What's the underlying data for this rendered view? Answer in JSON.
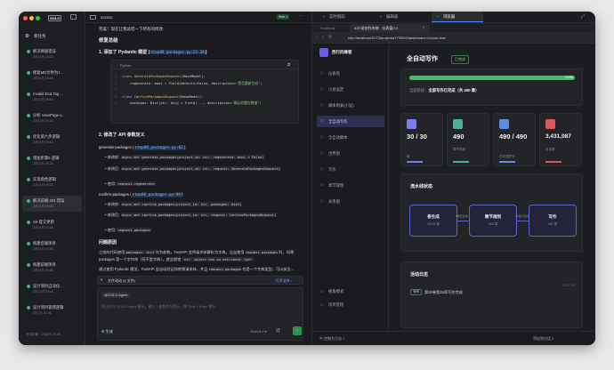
{
  "sidebar": {
    "brand": "SOLO",
    "new_task": "新任务",
    "items": [
      {
        "title": "解决降级错误",
        "date": "2月14日 18:02",
        "selected": false
      },
      {
        "title": "修复MD文件为J...",
        "date": "2月14日 06:44",
        "selected": false
      },
      {
        "title": "Invalid End Tag ...",
        "date": "2月14日 06:44",
        "selected": false
      },
      {
        "title": "分析 ViewPage.v...",
        "date": "2月14日 06:13",
        "selected": false
      },
      {
        "title": "优化第六步逻辑",
        "date": "2月14日 05:40",
        "selected": false
      },
      {
        "title": "增加步骤5 逻辑",
        "date": "2月14日 05:24",
        "selected": false
      },
      {
        "title": "实现角色逻辑",
        "date": "2月14日 05:23",
        "selected": false
      },
      {
        "title": "解决前端 404 错误",
        "date": "2月14日 05:06",
        "selected": true
      },
      {
        "title": "Git 提交更新",
        "date": "2月14日 04:48",
        "selected": false
      },
      {
        "title": "构建后端项目",
        "date": "2月14日 04:46",
        "selected": false
      },
      {
        "title": "构建前端项目",
        "date": "2月14日 04:48",
        "selected": false
      },
      {
        "title": "设计项目自动化...",
        "date": "2月14日 03:46",
        "selected": false
      },
      {
        "title": "设计项目管理逻辑",
        "date": "2月1日 21:46",
        "selected": false
      }
    ],
    "footer": "任务中断 · 2月8日 21:46"
  },
  "chat": {
    "title": "xxxxxx",
    "badge": "Web 1",
    "intro": "完美！现在让我总结一下所有的修改:",
    "h_summary": "修复总结",
    "s1": "1. 添加了 Pydantic 模型 (",
    "s1_code": "step08_packages.py:21-28",
    "s1_end": ")",
    "code_lang": "Python",
    "code1": [
      {
        "n": "1",
        "a": "class ",
        "b": "GeneratePackagesRequest",
        "c": "(BaseModel):"
      },
      {
        "n": "2",
        "a": "    ",
        "b": "regenerate: bool = Field(default=False, description=",
        "c": "\"是否重新生成\")"
      },
      {
        "n": "3",
        "a": "",
        "b": "",
        "c": ""
      },
      {
        "n": "4",
        "a": "class ",
        "b": "ConfirmPackagesRequest",
        "c": "(BaseModel):"
      },
      {
        "n": "5",
        "a": "    ",
        "b": "packages: Dict[str, Any] = Field(..., description=",
        "c": "\"确认的整包数据\")"
      }
    ],
    "s2": "2. 修改了 API 参数定义",
    "gen_label": "generate-packages (",
    "gen_code": "step08_packages.py:62",
    "gen_end": "):",
    "gen_before_label": "修改前:",
    "gen_before": "async def generate_packages(project_id: str, regenerate: bool = False)",
    "gen_after_label": "修改后:",
    "gen_after": "async def generate_packages(project_id: str, request: GeneratePackagesRequest)",
    "gen_use_label": "使用:",
    "gen_use": "request.regenerate",
    "conf_label": "confirm-packages (",
    "conf_code": "step08_packages.py:99",
    "conf_end": "):",
    "conf_before": "async def confirm_packages(project_id: str, packages: dict)",
    "conf_after": "async def confirm_packages(project_id: str, request: ConfirmPackagesRequest)",
    "conf_use": "request.packages",
    "h_reason": "问题原因",
    "reason1a": "之前的代码使用 ",
    "reason1b": "packages: dict",
    "reason1c": " 作为参数，FastAPI 会将请求体解析为字典。当当使用",
    "reason2a": "request.packages",
    "reason2b": " 时，如果 packages 是一个字符串（而不是字典），就会报错 ",
    "reason2c": "'str' object has no attribute 'get'",
    "reason3a": "通过使用 Pydantic 模型，FastAPI 会自动验证和转换请求体，并且 ",
    "reason3b": "request.packages",
    "reason3c": " 也是一个字典类型，可以安全...",
    "changes_bar": "文件改动 (6 文件)",
    "changes_link": "打开文件 ›",
    "agent": "@SOLO Agent",
    "input_placeholder": "您正在与 SOLO Agent 聊天，输入 / 查看命令提示，按 Shift + Enter 换行",
    "mode": "生成",
    "model": "GLM-5.1"
  },
  "right": {
    "tabs": [
      "实时跟踪",
      "编辑器",
      "浏览器"
    ],
    "browser_label": "Frontend",
    "page_tab": "AI小说创作系统 - 仪表盘2.0",
    "url": "http://localhost:5173/project/a773f392/dashboard-v2/auto-flow",
    "app_name": "西行四缘客",
    "menu": [
      "仪表盘",
      "小说设定",
      "脚本制表(小说)",
      "全自动写作",
      "全自动脚本",
      "世界观",
      "写作",
      "章节管理",
      "关系图"
    ],
    "menu_bottom": [
      "视角模式",
      "项目管理"
    ],
    "heading": "全自动写作",
    "status_tag": "已完成",
    "progress": 1.0,
    "progress_label": "100%",
    "current_stage_label": "当前阶段：",
    "current_stage": "全部写作已完成（共 490 章）",
    "stats": [
      {
        "value": "30 / 30",
        "label": "卷",
        "color": "#7b7ef2"
      },
      {
        "value": "490",
        "label": "章节规划",
        "color": "#4cae9b"
      },
      {
        "value": "490 / 490",
        "label": "已完成章节",
        "color": "#5b8ee6"
      },
      {
        "value": "3,431,087",
        "label": "总字数",
        "color": "#e05555"
      }
    ],
    "pipeline_title": "流水线状态",
    "pipeline": [
      {
        "title": "卷生成",
        "sub": "30/30 卷"
      },
      {
        "title": "章节规划",
        "sub": "490 章"
      },
      {
        "title": "写作",
        "sub": "490 章"
      }
    ],
    "pipeline_edges": [
      "5卷已就绪",
      "52章已完成"
    ],
    "activity_title": "活动日志",
    "activity": [
      {
        "tag": "写作",
        "text": "第30卷第15章写作完成",
        "time": "07:27:19"
      }
    ],
    "bottom_left": "控制台日志",
    "bottom_count": "2",
    "bottom_right": "添加到对话",
    "bottom_right_count": "2"
  }
}
